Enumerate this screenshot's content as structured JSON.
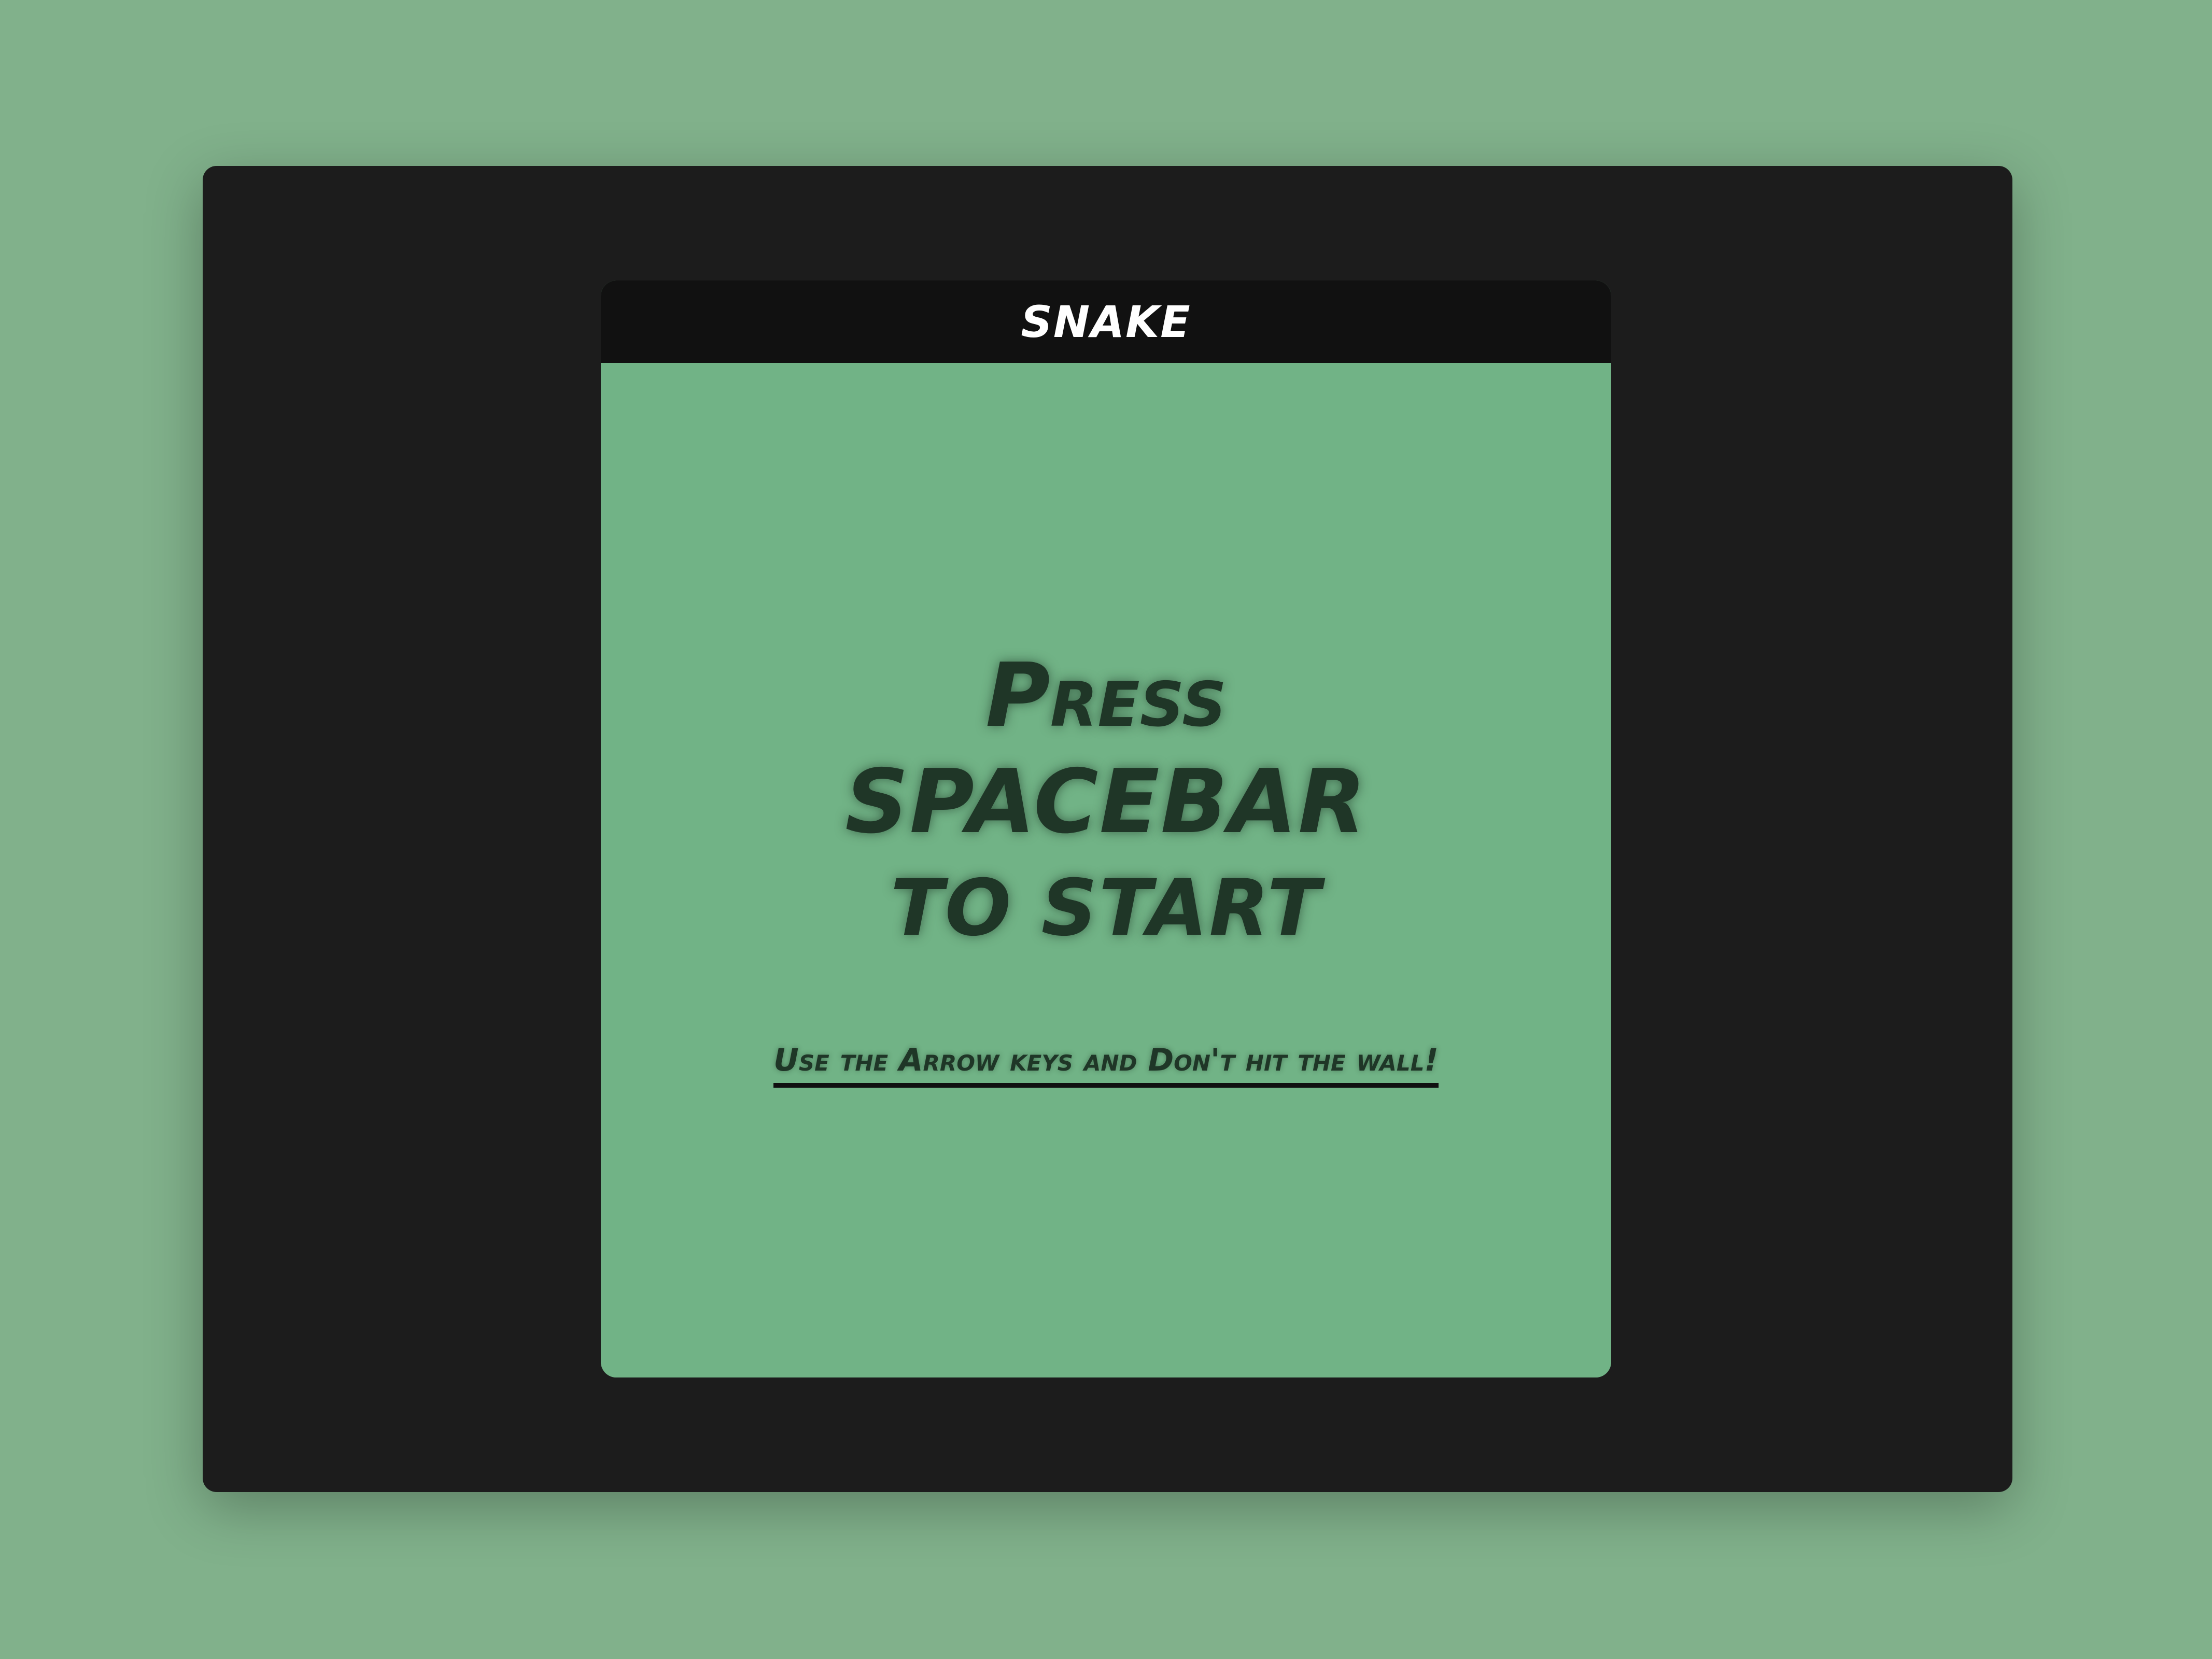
{
  "app": {
    "title": "SNAKE"
  },
  "game": {
    "start_line_1": "Press",
    "start_line_2": "SPACEBAR",
    "start_line_3": "to start",
    "hint": "Use the Arrow keys and Don't hit the wall!"
  },
  "colors": {
    "page_background": "#81b18b",
    "device_background": "#1c1c1c",
    "titlebar_background": "#111111",
    "playfield_background": "#71b386",
    "text_dark": "#1f3627"
  }
}
